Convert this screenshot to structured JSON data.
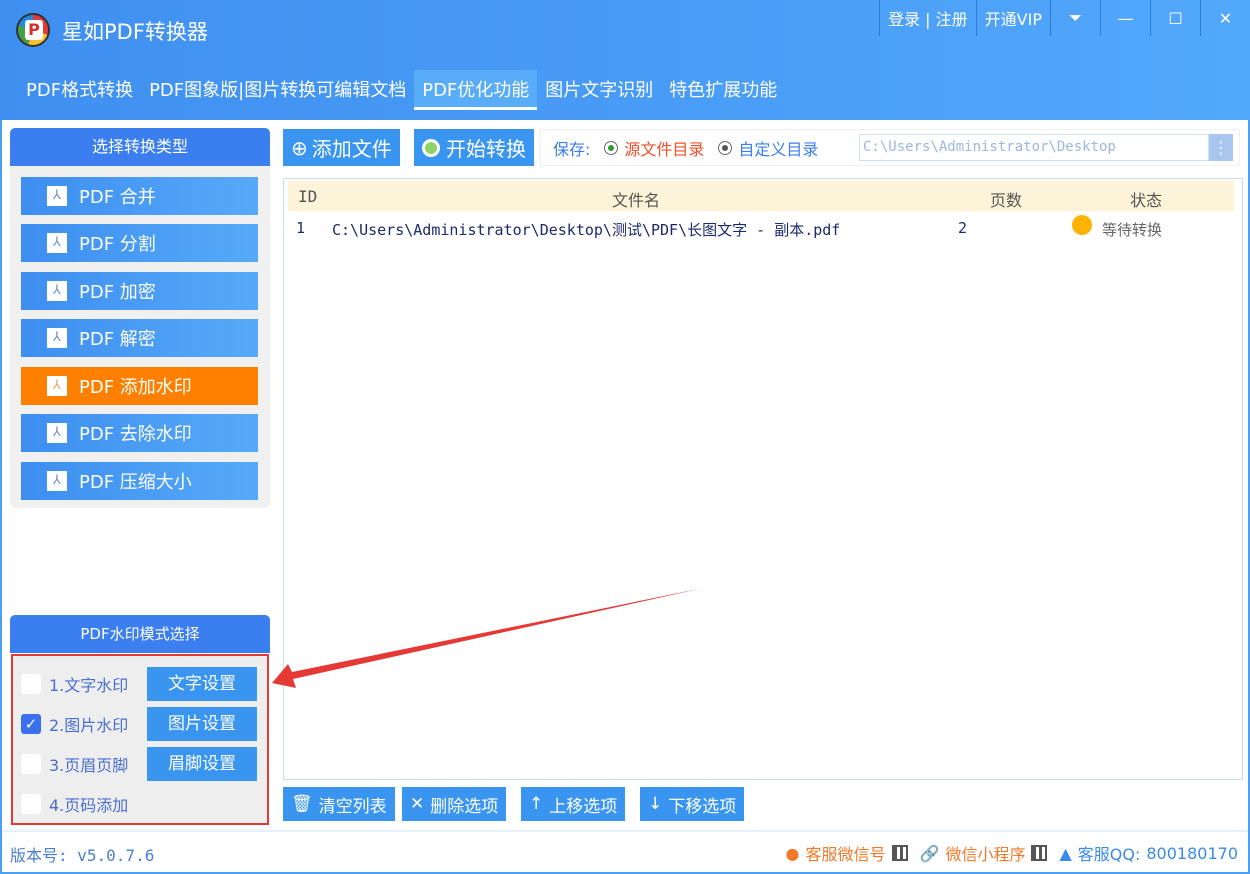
{
  "app": {
    "title": "星如PDF转换器",
    "login": "登录 | 注册",
    "vip": "开通VIP"
  },
  "tabs": [
    "PDF格式转换",
    "PDF图象版|图片转换可编辑文档",
    "PDF优化功能",
    "图片文字识别",
    "特色扩展功能"
  ],
  "sidebar": {
    "title": "选择转换类型",
    "items": [
      "PDF 合并",
      "PDF 分割",
      "PDF 加密",
      "PDF 解密",
      "PDF 添加水印",
      "PDF 去除水印",
      "PDF 压缩大小"
    ],
    "active": 4
  },
  "watermark": {
    "title": "PDF水印模式选择",
    "options": [
      {
        "label": "1.文字水印",
        "button": "文字设置",
        "checked": false
      },
      {
        "label": "2.图片水印",
        "button": "图片设置",
        "checked": true
      },
      {
        "label": "3.页眉页脚",
        "button": "眉脚设置",
        "checked": false
      },
      {
        "label": "4.页码添加",
        "checked": false
      }
    ]
  },
  "toolbar": {
    "add": "添加文件",
    "start": "开始转换",
    "save_label": "保存:",
    "opt_source": "源文件目录",
    "opt_custom": "自定义目录",
    "path": "C:\\Users\\Administrator\\Desktop",
    "more": "⋮"
  },
  "table": {
    "headers": [
      "ID",
      "文件名",
      "页数",
      "状态"
    ],
    "rows": [
      {
        "id": "1",
        "name": "C:\\Users\\Administrator\\Desktop\\测试\\PDF\\长图文字 - 副本.pdf",
        "pages": "2",
        "status": "等待转换"
      }
    ]
  },
  "actions": [
    "清空列表",
    "删除选项",
    "上移选项",
    "下移选项"
  ],
  "footer": {
    "version": "版本号: v5.0.7.6",
    "wechat": "客服微信号",
    "mini": "微信小程序",
    "qq": "客服QQ:",
    "qq_number": "800180170"
  }
}
